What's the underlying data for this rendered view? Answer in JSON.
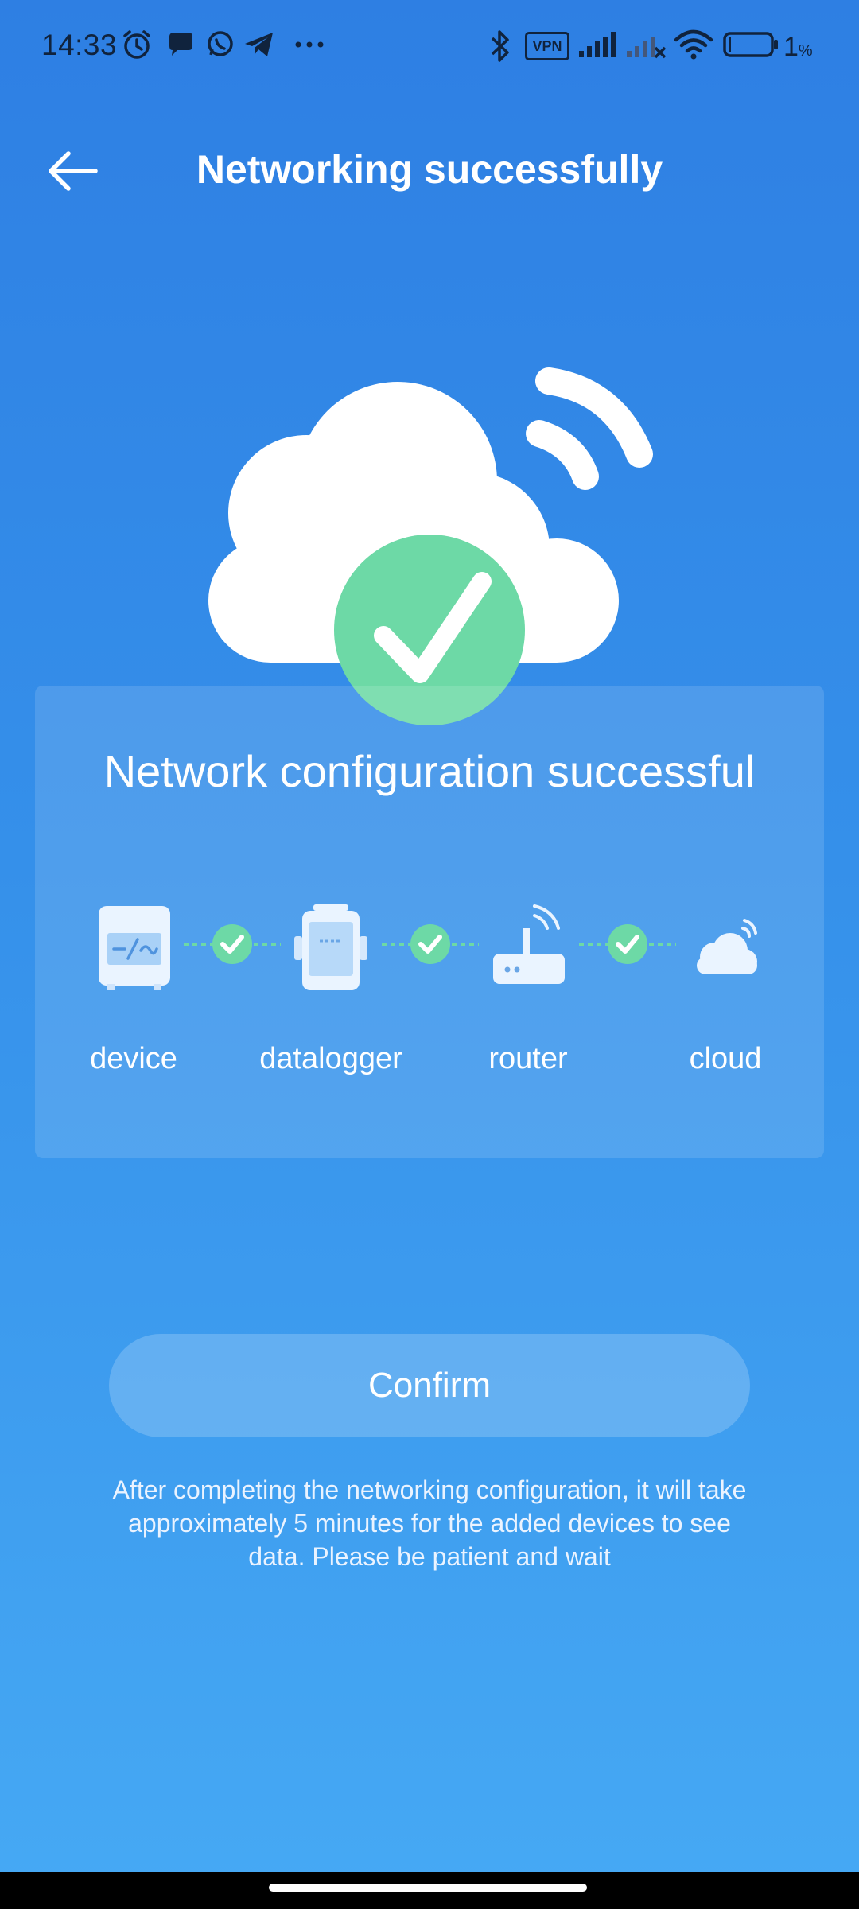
{
  "status_bar": {
    "time": "14:33",
    "vpn_label": "VPN",
    "battery_percent": "1",
    "battery_percent_sign": "%",
    "icons": [
      "alarm-icon",
      "chat-icon",
      "whatsapp-icon",
      "telegram-icon",
      "more-icon",
      "bluetooth-icon",
      "vpn-icon",
      "signal-icon",
      "signal-off-icon",
      "wifi-icon",
      "battery-icon"
    ]
  },
  "header": {
    "title": "Networking successfully",
    "back_icon": "back-arrow-icon"
  },
  "hero": {
    "icons": [
      "cloud-icon",
      "wifi-signal-icon",
      "success-check-icon"
    ]
  },
  "card": {
    "title": "Network configuration successful",
    "steps": [
      {
        "label": "device",
        "icon": "device-icon"
      },
      {
        "label": "datalogger",
        "icon": "datalogger-icon"
      },
      {
        "label": "router",
        "icon": "router-icon"
      },
      {
        "label": "cloud",
        "icon": "cloud-small-icon"
      }
    ],
    "connector_status": [
      "connected",
      "connected",
      "connected"
    ]
  },
  "confirm_label": "Confirm",
  "note": "After completing the networking configuration, it will take approximately 5 minutes for the added devices to see data. Please be patient and wait",
  "colors": {
    "background_top": "#2e7fe3",
    "background_bottom": "#46a9f4",
    "success_green": "#6dd9a6",
    "status_text": "#10233d"
  }
}
